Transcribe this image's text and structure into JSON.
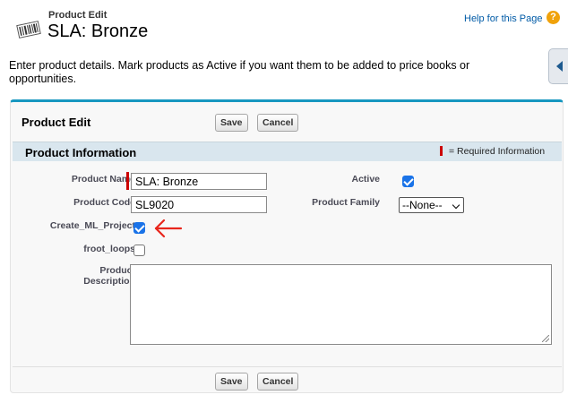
{
  "header": {
    "breadcrumb": "Product Edit",
    "title": "SLA: Bronze",
    "help_link": "Help for this Page",
    "help_icon_glyph": "?",
    "barcode_icon": "barcode-icon",
    "help_icon_color": "#f0a20b"
  },
  "intro": "Enter product details. Mark products as Active if you want them to be added to price books or opportunities.",
  "panel": {
    "title": "Product Edit",
    "save_label": "Save",
    "cancel_label": "Cancel",
    "accent_color": "#1797c0"
  },
  "section": {
    "title": "Product Information",
    "required_legend": "= Required Information",
    "required_color": "#cc0000"
  },
  "fields": {
    "product_name": {
      "label": "Product Name",
      "value": "SLA: Bronze",
      "required": true
    },
    "product_code": {
      "label": "Product Code",
      "value": "SL9020"
    },
    "active": {
      "label": "Active",
      "checked": true
    },
    "product_family": {
      "label": "Product Family",
      "selected": "--None--"
    },
    "create_ml_project": {
      "label": "Create_ML_Project",
      "checked": true
    },
    "froot_loops": {
      "label": "froot_loops",
      "checked": false
    },
    "product_description": {
      "label_line1": "Product",
      "label_line2": "Description",
      "value": ""
    }
  },
  "annotation": {
    "arrow_icon": "left-arrow-icon",
    "color": "#e8261c"
  }
}
